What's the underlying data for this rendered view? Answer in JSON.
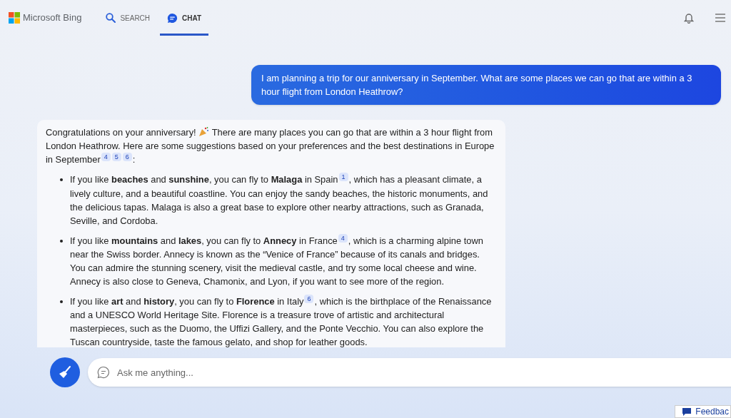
{
  "header": {
    "brand": "Microsoft Bing",
    "tabs": [
      {
        "label": "SEARCH",
        "kind": "search",
        "selected": false
      },
      {
        "label": "CHAT",
        "kind": "chat",
        "selected": true
      }
    ]
  },
  "user_message": "I am planning a trip for our anniversary in September. What are some places we can go that are within a 3 hour flight from London Heathrow?",
  "response": {
    "intro": {
      "before": "Congratulations on your anniversary!",
      "after": "There are many places you can go that are within a 3 hour flight from London Heathrow. Here are some suggestions based on your preferences and the best destinations in Europe in September",
      "citations": [
        "4",
        "5",
        "6"
      ],
      "end": ":"
    },
    "bullets": [
      {
        "text": "If you like **beaches** and **sunshine**, you can fly to **Malaga** in Spain",
        "citations": [
          "1"
        ],
        "rest": ", which has a pleasant climate, a lively culture, and a beautiful coastline. You can enjoy the sandy beaches, the historic monuments, and the delicious tapas. Malaga is also a great base to explore other nearby attractions, such as Granada, Seville, and Cordoba."
      },
      {
        "text": "If you like **mountains** and **lakes**, you can fly to **Annecy** in France",
        "citations": [
          "4"
        ],
        "rest": ", which is a charming alpine town near the Swiss border. Annecy is known as the “Venice of France” because of its canals and bridges. You can admire the stunning scenery, visit the medieval castle, and try some local cheese and wine. Annecy is also close to Geneva, Chamonix, and Lyon, if you want to see more of the region."
      },
      {
        "text": "If you like **art** and **history**, you can fly to **Florence** in Italy",
        "citations": [
          "6"
        ],
        "rest": ", which is the birthplace of the Renaissance and a UNESCO World Heritage Site. Florence is a treasure trove of artistic and architectural masterpieces, such as the Duomo, the Uffizi Gallery, and the Ponte Vecchio. You can also explore the Tuscan countryside, taste the famous gelato, and shop for leather goods."
      }
    ]
  },
  "input": {
    "placeholder": "Ask me anything..."
  },
  "feedback": "Feedbac"
}
